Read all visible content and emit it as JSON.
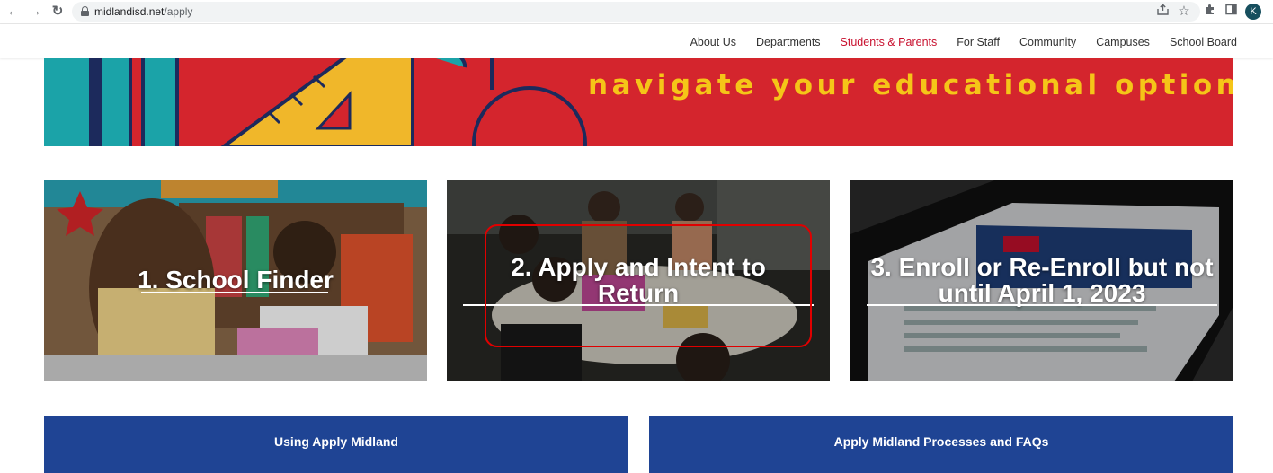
{
  "browser": {
    "url_domain": "midlandisd.net",
    "url_path": "/apply",
    "profile_initial": "K",
    "icons": [
      "back-arrow-icon",
      "forward-arrow-icon",
      "reload-icon",
      "lock-icon",
      "share-icon",
      "star-icon",
      "extensions-icon",
      "sidepanel-icon"
    ]
  },
  "nav": {
    "items": [
      {
        "label": "About Us"
      },
      {
        "label": "Departments"
      },
      {
        "label": "Students & Parents",
        "active": true
      },
      {
        "label": "For Staff"
      },
      {
        "label": "Community"
      },
      {
        "label": "Campuses"
      },
      {
        "label": "School Board"
      }
    ],
    "active_color": "#c8102e"
  },
  "banner": {
    "tagline": "navigate your educational options",
    "bg_color": "#d4252d",
    "text_color": "#f5c518"
  },
  "cards": [
    {
      "title": "1. School Finder"
    },
    {
      "title_line1": "2. Apply and Intent to",
      "title_line2": "Return"
    },
    {
      "title_line1": "3. Enroll or Re-Enroll but not",
      "title_line2": "until April 1, 2023"
    }
  ],
  "buttons": {
    "using_apply": "Using Apply Midland",
    "processes_faqs": "Apply Midland Processes and FAQs",
    "color": "#1f4494"
  }
}
